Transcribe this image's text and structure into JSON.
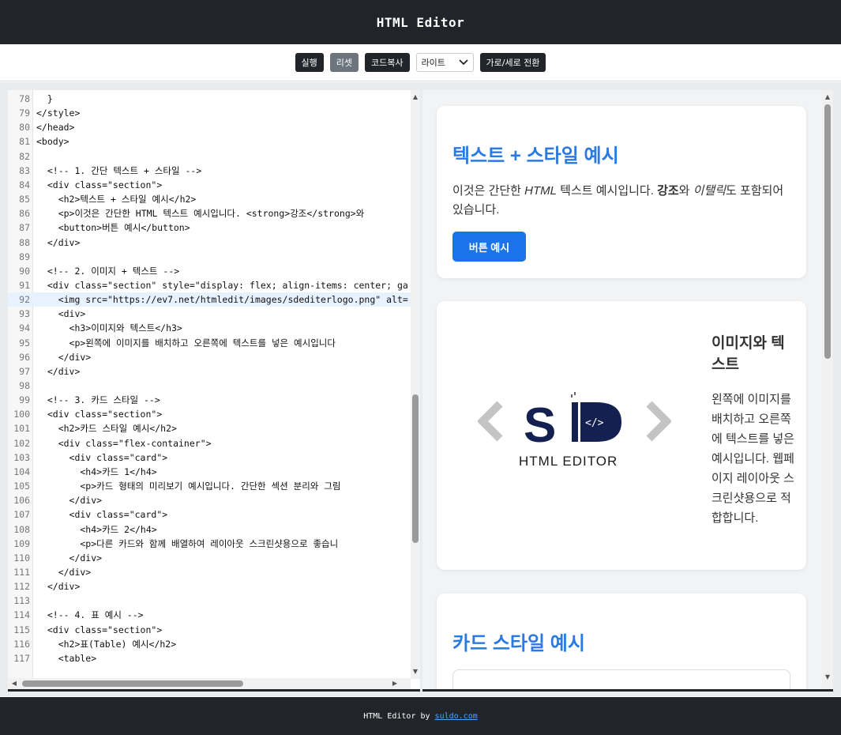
{
  "app": {
    "title": "HTML Editor"
  },
  "toolbar": {
    "run_label": "실행",
    "reset_label": "리셋",
    "copy_label": "코드복사",
    "theme_value": "라이트",
    "layout_label": "가로/세로 전환"
  },
  "editor": {
    "lines": [
      {
        "num": "78",
        "text": "  }"
      },
      {
        "num": "79",
        "text": "</style>"
      },
      {
        "num": "80",
        "text": "</head>"
      },
      {
        "num": "81",
        "text": "<body>"
      },
      {
        "num": "82",
        "text": ""
      },
      {
        "num": "83",
        "text": "  <!-- 1. 간단 텍스트 + 스타일 -->"
      },
      {
        "num": "84",
        "text": "  <div class=\"section\">"
      },
      {
        "num": "85",
        "text": "    <h2>텍스트 + 스타일 예시</h2>"
      },
      {
        "num": "86",
        "text": "    <p>이것은 간단한 HTML 텍스트 예시입니다. <strong>강조</strong>와"
      },
      {
        "num": "87",
        "text": "    <button>버튼 예시</button>"
      },
      {
        "num": "88",
        "text": "  </div>"
      },
      {
        "num": "89",
        "text": ""
      },
      {
        "num": "90",
        "text": "  <!-- 2. 이미지 + 텍스트 -->"
      },
      {
        "num": "91",
        "text": "  <div class=\"section\" style=\"display: flex; align-items: center; ga"
      },
      {
        "num": "92",
        "text": "    <img src=\"https://ev7.net/htmledit/images/sdediterlogo.png\" alt="
      },
      {
        "num": "93",
        "text": "    <div>"
      },
      {
        "num": "94",
        "text": "      <h3>이미지와 텍스트</h3>"
      },
      {
        "num": "95",
        "text": "      <p>왼쪽에 이미지를 배치하고 오른쪽에 텍스트를 넣은 예시입니다"
      },
      {
        "num": "96",
        "text": "    </div>"
      },
      {
        "num": "97",
        "text": "  </div>"
      },
      {
        "num": "98",
        "text": ""
      },
      {
        "num": "99",
        "text": "  <!-- 3. 카드 스타일 -->"
      },
      {
        "num": "100",
        "text": "  <div class=\"section\">"
      },
      {
        "num": "101",
        "text": "    <h2>카드 스타일 예시</h2>"
      },
      {
        "num": "102",
        "text": "    <div class=\"flex-container\">"
      },
      {
        "num": "103",
        "text": "      <div class=\"card\">"
      },
      {
        "num": "104",
        "text": "        <h4>카드 1</h4>"
      },
      {
        "num": "105",
        "text": "        <p>카드 형태의 미리보기 예시입니다. 간단한 섹션 분리와 그림"
      },
      {
        "num": "106",
        "text": "      </div>"
      },
      {
        "num": "107",
        "text": "      <div class=\"card\">"
      },
      {
        "num": "108",
        "text": "        <h4>카드 2</h4>"
      },
      {
        "num": "109",
        "text": "        <p>다른 카드와 함께 배열하여 레이아웃 스크린샷용으로 좋습니"
      },
      {
        "num": "110",
        "text": "      </div>"
      },
      {
        "num": "111",
        "text": "    </div>"
      },
      {
        "num": "112",
        "text": "  </div>"
      },
      {
        "num": "113",
        "text": ""
      },
      {
        "num": "114",
        "text": "  <!-- 4. 표 예시 -->"
      },
      {
        "num": "115",
        "text": "  <div class=\"section\">"
      },
      {
        "num": "116",
        "text": "    <h2>표(Table) 예시</h2>"
      },
      {
        "num": "117",
        "text": "    <table>"
      }
    ]
  },
  "preview": {
    "section1": {
      "heading": "텍스트 + 스타일 예시",
      "para_pre": "이것은 간단한 ",
      "para_html": "HTML",
      "para_mid": " 텍스트 예시입니다. ",
      "para_strong": "강조",
      "para_mid2": "와 ",
      "para_em": "이탤릭",
      "para_post": "도 포함되어 있습니다.",
      "button_label": "버튼 예시"
    },
    "section2": {
      "logo_text": "HTML EDITOR",
      "heading": "이미지와 텍스트",
      "para": "왼쪽에 이미지를 배치하고 오른쪽에 텍스트를 넣은 예시입니다. 웹페이지 레이아웃 스크린샷용으로 적합합니다."
    },
    "section3": {
      "heading": "카드 스타일 예시"
    }
  },
  "footer": {
    "text": "HTML Editor by",
    "link_text": "suldo.com"
  },
  "colors": {
    "accent": "#1a73e8",
    "heading_blue": "#2a7ae2",
    "dark": "#212529"
  }
}
